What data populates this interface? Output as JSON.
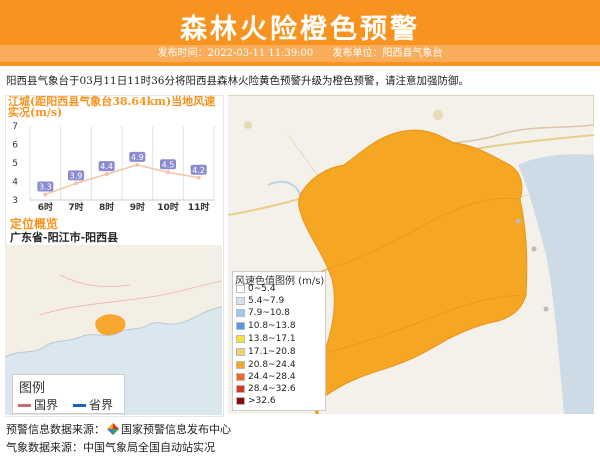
{
  "header": {
    "title": "森林火险橙色预警",
    "publish_time": "发布时间：2022-03-11 11:39:00",
    "publisher": "发布单位：阳西县气象台",
    "bg_color": "#f7931e"
  },
  "summary": "阳西县气象台于03月11日11时36分将阳西县森林火险黄色预警升级为橙色预警，请注意加强防御。",
  "wind_panel": {
    "title": "江城(距阳西县气象台38.64km)当地风速实况(m/s)",
    "chart_data": {
      "type": "line",
      "categories": [
        "6时",
        "7时",
        "8时",
        "9时",
        "10时",
        "11时"
      ],
      "values": [
        3.3,
        3.9,
        4.4,
        4.9,
        4.5,
        4.2
      ],
      "ylim": [
        3,
        5
      ],
      "yticks": [
        "3",
        "4",
        "5",
        "6",
        "7"
      ],
      "grid": true,
      "line_color": "#f3c4a6",
      "label_color": "#8b8ccf"
    }
  },
  "location": {
    "title": "定位概览",
    "text": "广东省-阳江市-阳西县"
  },
  "legend_border": {
    "title": "图例",
    "items": [
      {
        "label": "国界",
        "color": "#c76b6b"
      },
      {
        "label": "省界",
        "color": "#1f5fbf"
      }
    ]
  },
  "legend_wind": {
    "title": "风速色值图例 (m/s)",
    "items": [
      {
        "label": "0~5.4",
        "color": "#ffffff"
      },
      {
        "label": "5.4~7.9",
        "color": "#cfe3f5"
      },
      {
        "label": "7.9~10.8",
        "color": "#a3c8ef"
      },
      {
        "label": "10.8~13.8",
        "color": "#5b94e4"
      },
      {
        "label": "13.8~17.1",
        "color": "#f5e23b"
      },
      {
        "label": "17.1~20.8",
        "color": "#f7d070"
      },
      {
        "label": "20.8~24.4",
        "color": "#f5a623"
      },
      {
        "label": "24.4~28.4",
        "color": "#f06a1d"
      },
      {
        "label": "28.4~32.6",
        "color": "#d9361b"
      },
      {
        "label": ">32.6",
        "color": "#8b0a0a"
      }
    ]
  },
  "footer": {
    "warning_source_label": "预警信息数据来源：",
    "warning_source": "国家预警信息发布中心",
    "weather_source": "气象数据来源：中国气象局全国自动站实况"
  }
}
